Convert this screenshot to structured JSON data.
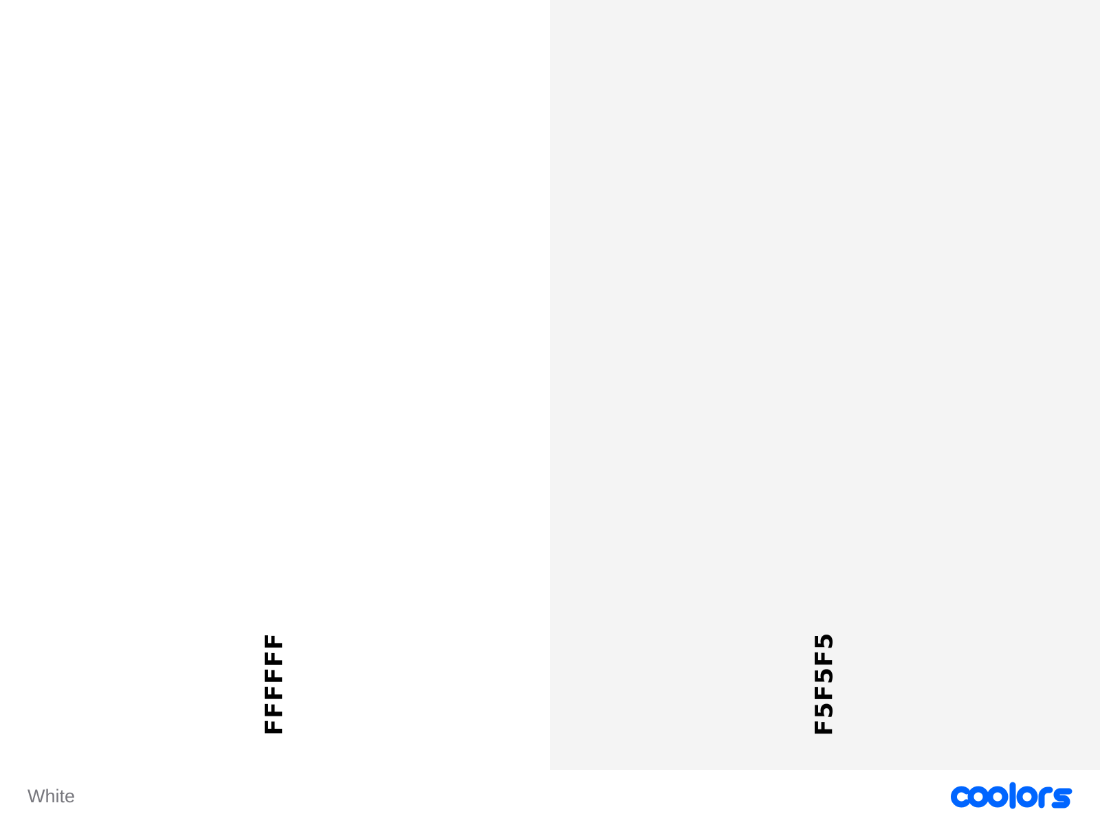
{
  "palette": {
    "name": "White",
    "swatches": [
      {
        "hex": "FFFFFF",
        "color": "#FFFFFF"
      },
      {
        "hex": "F5F5F5",
        "color": "#F4F4F4"
      }
    ]
  },
  "brand": {
    "logo_text": "coolors",
    "color": "#0065FF"
  },
  "colors": {
    "label_text": "#000000",
    "palette_name_text": "#77777D",
    "footer_background": "#FFFFFF"
  }
}
